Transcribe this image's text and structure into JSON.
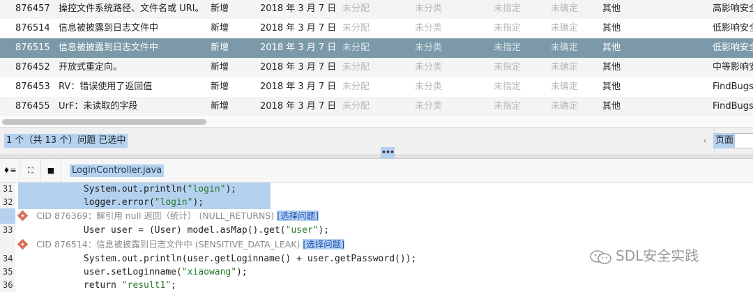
{
  "issues": [
    {
      "id": "876457",
      "title": "操控文件系统路径、文件名或 URI。",
      "status": "新增",
      "date": "2018 年 3 月 7 日",
      "owner": "未分配",
      "classification": "未分类",
      "action": "未指定",
      "severity": "未确定",
      "category": "其他",
      "impact": "高影响安全"
    },
    {
      "id": "876514",
      "title": "信息被披露到日志文件中",
      "status": "新增",
      "date": "2018 年 3 月 7 日",
      "owner": "未分配",
      "classification": "未分类",
      "action": "未指定",
      "severity": "未确定",
      "category": "其他",
      "impact": "低影响安全"
    },
    {
      "id": "876515",
      "title": "信息被披露到日志文件中",
      "status": "新增",
      "date": "2018 年 3 月 7 日",
      "owner": "未分配",
      "classification": "未分类",
      "action": "未指定",
      "severity": "未确定",
      "category": "其他",
      "impact": "低影响安全",
      "selected": true
    },
    {
      "id": "876452",
      "title": "开放式重定向。",
      "status": "新增",
      "date": "2018 年 3 月 7 日",
      "owner": "未分配",
      "classification": "未分类",
      "action": "未指定",
      "severity": "未确定",
      "category": "其他",
      "impact": "中等影响安"
    },
    {
      "id": "876453",
      "title": "RV：错误使用了返回值",
      "status": "新增",
      "date": "2018 年 3 月 7 日",
      "owner": "未分配",
      "classification": "未分类",
      "action": "未指定",
      "severity": "未确定",
      "category": "其他",
      "impact": "FindBugs"
    },
    {
      "id": "876455",
      "title": "UrF：未读取的字段",
      "status": "新增",
      "date": "2018 年 3 月 7 日",
      "owner": "未分配",
      "classification": "未分类",
      "action": "未指定",
      "severity": "未确定",
      "category": "其他",
      "impact": "FindBugs"
    }
  ],
  "status_bar": {
    "selection_text": "1 个（共 13 个）问题 已选中",
    "prev_icon": "chevron-left-icon",
    "prev_glyph": "‹",
    "page_label": "页面",
    "page_value": ""
  },
  "splitter": {
    "grip": "•••"
  },
  "source_toolbar": {
    "toggle_glyph": "♦≡",
    "expand_glyph": "⛶",
    "folder_glyph": "■",
    "file_name": "LoginController.java"
  },
  "code": {
    "lines": [
      {
        "num": "31",
        "pre": "            System.out.println(",
        "str": "\"login\"",
        "post": ");"
      },
      {
        "num": "32",
        "pre": "            logger.error(",
        "str": "\"login\"",
        "post": ");"
      }
    ],
    "issue1": {
      "text": "CID 876369：解引用 null 返回（统计） (NULL_RETURNS) ",
      "link": "[选择问题]"
    },
    "line33": {
      "num": "33",
      "pre": "            User user = (User) model.asMap().get(",
      "str": "\"user\"",
      "post": ");"
    },
    "issue2": {
      "text": "CID 876514：信息被披露到日志文件中 (SENSITIVE_DATA_LEAK) ",
      "link": "[选择问题]"
    },
    "tail": [
      {
        "num": "34",
        "pre": "            System.out.println(user.getLoginname() + user.getPassword());",
        "str": "",
        "post": ""
      },
      {
        "num": "35",
        "pre": "            user.setLoginname(",
        "str": "\"xiaowang\"",
        "post": ");"
      },
      {
        "num": "36",
        "pre": "            return ",
        "str": "\"result1\"",
        "post": ";"
      }
    ]
  },
  "watermark": {
    "text": "SDL安全实践",
    "icon": "wechat-icon"
  },
  "colors": {
    "selected_row": "#7b99a8",
    "selection_highlight": "#b4d2f0",
    "warning": "#d9705a",
    "link": "#1f4fb8"
  }
}
